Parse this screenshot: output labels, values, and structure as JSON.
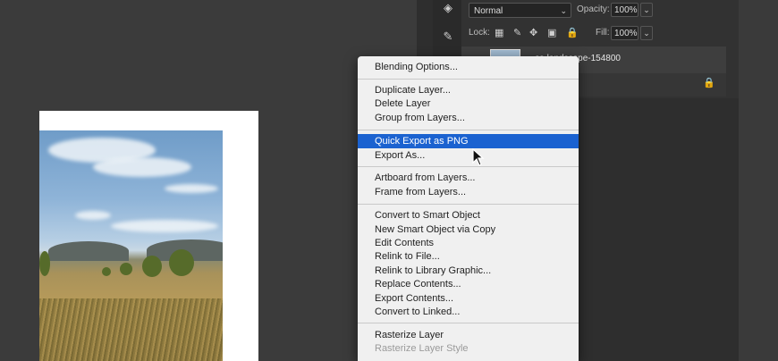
{
  "options_bar": {
    "blend_mode": "Normal",
    "opacity_label": "Opacity:",
    "opacity_value": "100%",
    "lock_label": "Lock:",
    "fill_label": "Fill:",
    "fill_value": "100%"
  },
  "layers": {
    "selected_layer_name": "...ss-landscape-154800"
  },
  "context_menu": {
    "items": [
      {
        "label": "Blending Options..."
      },
      {
        "label": "Duplicate Layer..."
      },
      {
        "label": "Delete Layer"
      },
      {
        "label": "Group from Layers..."
      },
      {
        "label": "Quick Export as PNG",
        "highlighted": true
      },
      {
        "label": "Export As..."
      },
      {
        "label": "Artboard from Layers..."
      },
      {
        "label": "Frame from Layers..."
      },
      {
        "label": "Convert to Smart Object"
      },
      {
        "label": "New Smart Object via Copy"
      },
      {
        "label": "Edit Contents"
      },
      {
        "label": "Relink to File..."
      },
      {
        "label": "Relink to Library Graphic..."
      },
      {
        "label": "Replace Contents..."
      },
      {
        "label": "Export Contents..."
      },
      {
        "label": "Convert to Linked..."
      },
      {
        "label": "Rasterize Layer"
      },
      {
        "label": "Rasterize Layer Style",
        "disabled": true
      }
    ]
  },
  "colors": {
    "highlight": "#1b62d0",
    "menu_bg": "#f0f0f0",
    "panel_bg": "#2e2e2e"
  }
}
